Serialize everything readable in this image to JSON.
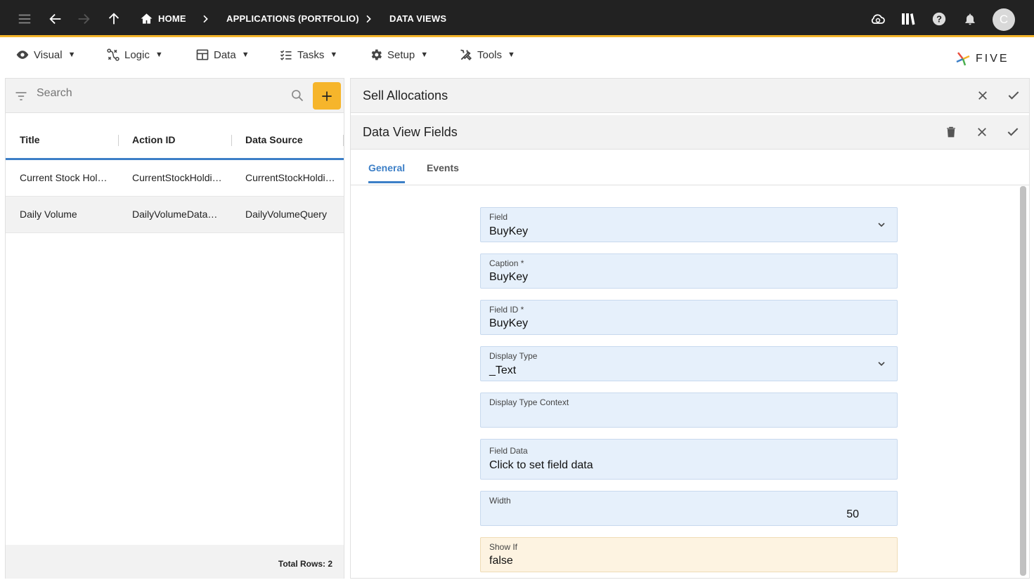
{
  "topbar": {
    "breadcrumbs": [
      "HOME",
      "APPLICATIONS (PORTFOLIO)",
      "DATA VIEWS"
    ],
    "avatar_initial": "C",
    "accent_color": "#f4b42a"
  },
  "menu": {
    "items": [
      {
        "label": "Visual",
        "icon": "eye-icon"
      },
      {
        "label": "Logic",
        "icon": "logic-icon"
      },
      {
        "label": "Data",
        "icon": "table-icon"
      },
      {
        "label": "Tasks",
        "icon": "tasks-icon"
      },
      {
        "label": "Setup",
        "icon": "gear-icon"
      },
      {
        "label": "Tools",
        "icon": "tools-icon"
      }
    ],
    "brand": "FIVE"
  },
  "left_panel": {
    "search_placeholder": "Search",
    "columns": [
      "Title",
      "Action ID",
      "Data Source"
    ],
    "rows": [
      [
        "Current Stock Holdings",
        "CurrentStockHoldings",
        "CurrentStockHoldings"
      ],
      [
        "Daily Volume",
        "DailyVolumeDataView",
        "DailyVolumeQuery"
      ]
    ],
    "total_rows": "Total Rows: 2"
  },
  "right_panel": {
    "parent_title": "Sell Allocations",
    "form_title": "Data View Fields",
    "tabs": [
      "General",
      "Events"
    ],
    "active_tab": "General",
    "fields": {
      "field": {
        "label": "Field",
        "value": "BuyKey"
      },
      "caption": {
        "label": "Caption *",
        "value": "BuyKey"
      },
      "field_id": {
        "label": "Field ID *",
        "value": "BuyKey"
      },
      "display_type": {
        "label": "Display Type",
        "value": "_Text"
      },
      "display_type_context": {
        "label": "Display Type Context",
        "value": ""
      },
      "field_data": {
        "label": "Field Data",
        "value": "Click to set field data"
      },
      "width": {
        "label": "Width",
        "value": "50"
      },
      "show_if": {
        "label": "Show If",
        "value": "false"
      }
    }
  },
  "colors": {
    "primary": "#3c7fc7",
    "add_button": "#f6b52b",
    "field_bg": "#e6f0fb"
  }
}
